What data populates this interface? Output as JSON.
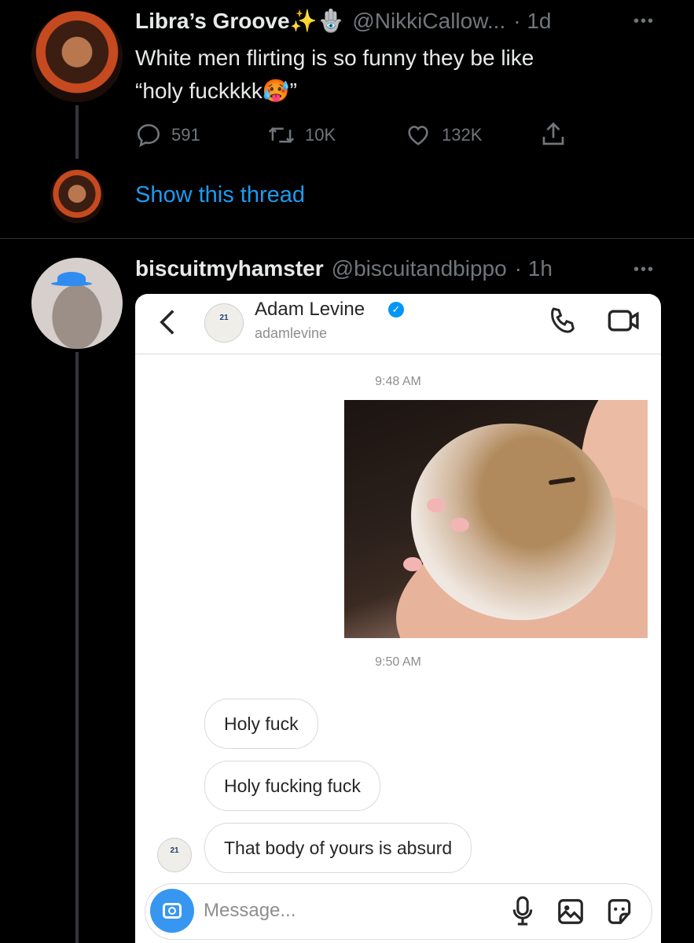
{
  "tweet1": {
    "display_name": "Libra’s Groove✨🪬",
    "handle": "@NikkiCallow...",
    "time": "· 1d",
    "text_line1": "White men flirting is so funny they be like",
    "text_line2": "“holy fuckkkk🥵”",
    "replies": "591",
    "retweets": "10K",
    "likes": "132K",
    "show_thread": "Show this thread"
  },
  "tweet2": {
    "display_name": "biscuitmyhamster",
    "handle": "@biscuitandbippo",
    "time": "· 1h",
    "dm_screenshot": {
      "contact_name": "Adam Levine",
      "contact_username": "adamlevine",
      "jersey_text": "21",
      "time_1": "9:48 AM",
      "time_2": "9:50 AM",
      "messages": [
        "Holy fuck",
        "Holy fucking fuck",
        "That body of yours is absurd"
      ],
      "message_placeholder": "Message..."
    }
  },
  "colors": {
    "background": "#000000",
    "link_blue": "#1d9bf0",
    "muted_gray": "#71767b",
    "ig_blue": "#3797f0",
    "verified_blue": "#0095f6"
  },
  "icons": [
    "reply-icon",
    "retweet-icon",
    "like-icon",
    "share-icon",
    "more-icon",
    "back-chevron-icon",
    "phone-icon",
    "video-icon",
    "verified-icon",
    "camera-icon",
    "microphone-icon",
    "gallery-icon",
    "sticker-icon"
  ]
}
